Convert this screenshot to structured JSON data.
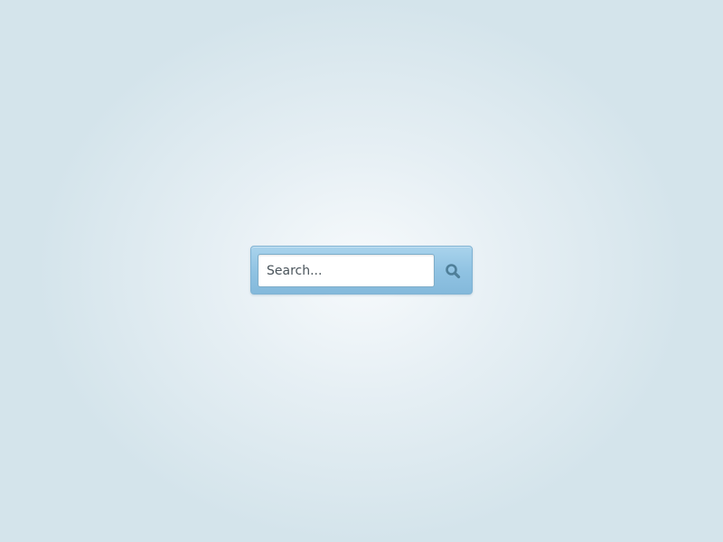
{
  "search": {
    "placeholder": "Search...",
    "value": "",
    "button_icon": "search-icon"
  },
  "colors": {
    "background_center": "#f7fafc",
    "background_edge": "#d4e4eb",
    "bar_fill": "#93c6e4",
    "bar_border": "#7fb2d3",
    "input_fill": "#ffffff",
    "icon_color": "#4f7f99"
  }
}
